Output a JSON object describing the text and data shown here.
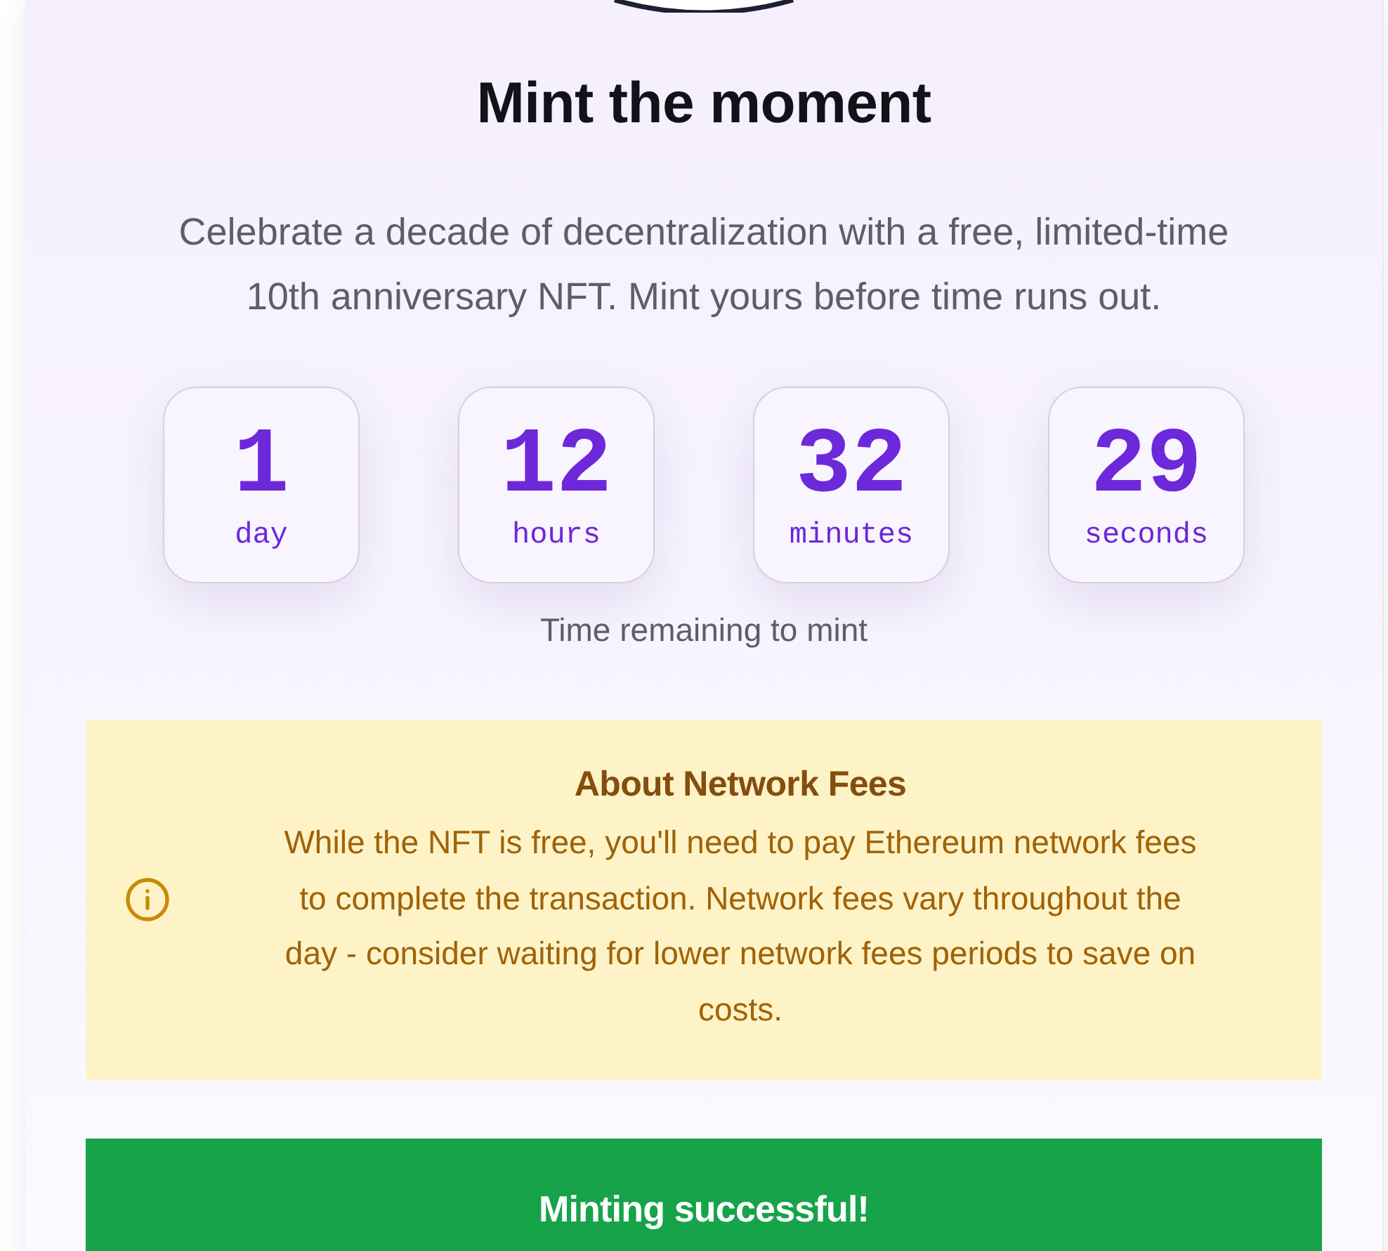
{
  "hero": {
    "title": "Mint the moment",
    "description": "Celebrate a decade of decentralization with a free, limited-time 10th anniversary NFT. Mint yours before time runs out."
  },
  "countdown": {
    "units": [
      {
        "value": "1",
        "unit": "day"
      },
      {
        "value": "12",
        "unit": "hours"
      },
      {
        "value": "32",
        "unit": "minutes"
      },
      {
        "value": "29",
        "unit": "seconds"
      }
    ],
    "caption": "Time remaining to mint"
  },
  "fee_notice": {
    "title": "About Network Fees",
    "body": "While the NFT is free, you'll need to pay Ethereum network fees to complete the transaction. Network fees vary throughout the day - consider waiting for lower network fees periods to save on costs."
  },
  "status_banner": {
    "kind": "success",
    "message": "Minting successful!"
  }
}
